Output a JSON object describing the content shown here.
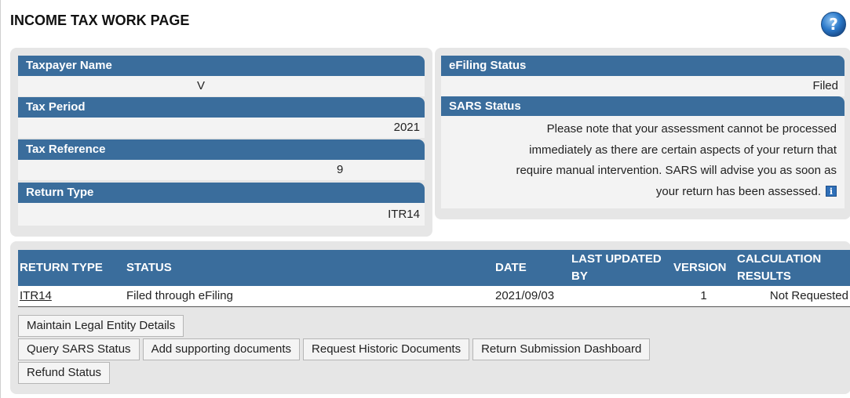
{
  "page": {
    "title": "INCOME TAX WORK PAGE",
    "help_icon": "question-mark-icon"
  },
  "taxpayer": {
    "name_label": "Taxpayer Name",
    "name_value": "V",
    "period_label": "Tax Period",
    "period_value": "2021",
    "reference_label": "Tax Reference",
    "reference_value": "9",
    "return_type_label": "Return Type",
    "return_type_value": "ITR14"
  },
  "status": {
    "efiling_label": "eFiling Status",
    "efiling_value": "Filed",
    "sars_label": "SARS Status",
    "sars_lines": [
      "Please note that your assessment cannot be processed",
      "immediately as there are certain aspects of your return that",
      "require manual intervention. SARS will advise you as soon as",
      "your return has been assessed."
    ],
    "info_icon": "information-icon"
  },
  "returns_table": {
    "headers": [
      "RETURN TYPE",
      "STATUS",
      "DATE",
      "LAST UPDATED BY",
      "VERSION",
      "CALCULATION RESULTS"
    ],
    "rows": [
      {
        "return_type": "ITR14",
        "status": "Filed through eFiling",
        "date": "2021/09/03",
        "last_updated_by": "",
        "version": "1",
        "calculation_results": "Not Requested"
      }
    ]
  },
  "buttons": {
    "maintain_legal_entity": "Maintain Legal Entity Details",
    "query_sars_status": "Query SARS Status",
    "add_supporting_documents": "Add supporting documents",
    "request_historic_documents": "Request Historic Documents",
    "return_submission_dashboard": "Return Submission Dashboard",
    "refund_status": "Refund Status"
  },
  "colors": {
    "header_blue": "#3a6d9c",
    "panel_grey": "#e6e6e6",
    "row_grey": "#f3f3f3"
  }
}
